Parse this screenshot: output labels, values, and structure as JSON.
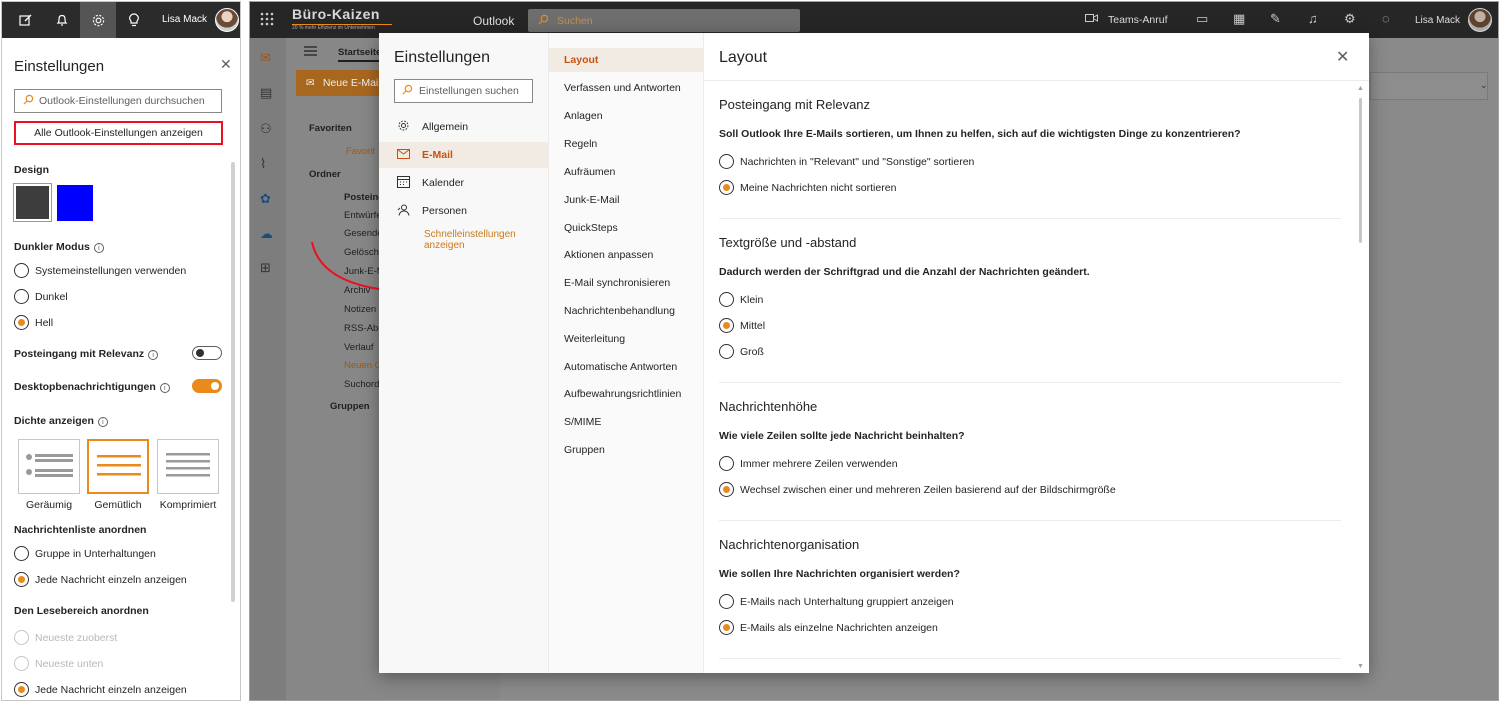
{
  "left_panel": {
    "user_name": "Lisa Mack",
    "title": "Einstellungen",
    "search_placeholder": "Outlook-Einstellungen durchsuchen",
    "all_settings_label": "Alle Outlook-Einstellungen anzeigen",
    "design_label": "Design",
    "swatches": [
      "#3d3d3d",
      "#0000ff"
    ],
    "dark_mode_label": "Dunkler Modus",
    "dark_mode_options": [
      {
        "label": "Systemeinstellungen verwenden",
        "checked": false
      },
      {
        "label": "Dunkel",
        "checked": false
      },
      {
        "label": "Hell",
        "checked": true
      }
    ],
    "focused_inbox_label": "Posteingang mit Relevanz",
    "focused_inbox_on": false,
    "desktop_notifications_label": "Desktopbenachrichtigungen",
    "desktop_notifications_on": true,
    "density_label": "Dichte anzeigen",
    "density_options": [
      "Geräumig",
      "Gemütlich",
      "Komprimiert"
    ],
    "density_selected": 1,
    "message_list_label": "Nachrichtenliste anordnen",
    "message_list_options": [
      {
        "label": "Gruppe in Unterhaltungen",
        "checked": false
      },
      {
        "label": "Jede Nachricht einzeln anzeigen",
        "checked": true
      }
    ],
    "reading_pane_label": "Den Lesebereich anordnen",
    "reading_pane_options": [
      {
        "label": "Neueste zuoberst",
        "checked": false,
        "disabled": true
      },
      {
        "label": "Neueste unten",
        "checked": false,
        "disabled": true
      },
      {
        "label": "Jede Nachricht einzeln anzeigen",
        "checked": true,
        "disabled": false
      }
    ]
  },
  "main": {
    "brand": "Büro-Kaizen",
    "brand_tagline": "20 % mehr Effizienz im Unternehmen",
    "app_name": "Outlook",
    "search_placeholder": "Suchen",
    "teams_call": "Teams-Anruf",
    "user_name": "Lisa Mack",
    "tab_label": "Startseite",
    "new_mail_label": "Neue E-Mail",
    "folders": {
      "favorites": "Favoriten",
      "favorites_item": "Favorit",
      "folder": "Ordner",
      "items": [
        "Posteingang",
        "Entwürfe",
        "Gesendet",
        "Gelöscht",
        "Junk-E-Mail",
        "Archiv",
        "Notizen",
        "RSS-Abo",
        "Verlauf",
        "Neuen Ordner",
        "Suchordner"
      ],
      "groups": "Gruppen"
    }
  },
  "modal": {
    "nav_title": "Einstellungen",
    "nav_search_placeholder": "Einstellungen suchen",
    "nav_items": [
      {
        "label": "Allgemein",
        "icon": "gear-icon"
      },
      {
        "label": "E-Mail",
        "icon": "mail-icon"
      },
      {
        "label": "Kalender",
        "icon": "calendar-icon"
      },
      {
        "label": "Personen",
        "icon": "people-icon"
      }
    ],
    "nav_active": 1,
    "quick_settings_link": "Schnelleinstellungen anzeigen",
    "sub_items": [
      "Layout",
      "Verfassen und Antworten",
      "Anlagen",
      "Regeln",
      "Aufräumen",
      "Junk-E-Mail",
      "QuickSteps",
      "Aktionen anpassen",
      "E-Mail synchronisieren",
      "Nachrichtenbehandlung",
      "Weiterleitung",
      "Automatische Antworten",
      "Aufbewahrungsrichtlinien",
      "S/MIME",
      "Gruppen"
    ],
    "sub_active": 0,
    "content_title": "Layout",
    "sections": [
      {
        "heading": "Posteingang mit Relevanz",
        "question": "Soll Outlook Ihre E-Mails sortieren, um Ihnen zu helfen, sich auf die wichtigsten Dinge zu konzentrieren?",
        "options": [
          {
            "label": "Nachrichten in \"Relevant\" und \"Sonstige\" sortieren",
            "checked": false
          },
          {
            "label": "Meine Nachrichten nicht sortieren",
            "checked": true
          }
        ]
      },
      {
        "heading": "Textgröße und -abstand",
        "question": "Dadurch werden der Schriftgrad und die Anzahl der Nachrichten geändert.",
        "options": [
          {
            "label": "Klein",
            "checked": false
          },
          {
            "label": "Mittel",
            "checked": true
          },
          {
            "label": "Groß",
            "checked": false
          }
        ]
      },
      {
        "heading": "Nachrichtenhöhe",
        "question": "Wie viele Zeilen sollte jede Nachricht beinhalten?",
        "options": [
          {
            "label": "Immer mehrere Zeilen verwenden",
            "checked": false
          },
          {
            "label": "Wechsel zwischen einer und mehreren Zeilen basierend auf der Bildschirmgröße",
            "checked": true
          }
        ]
      },
      {
        "heading": "Nachrichtenorganisation",
        "question": "Wie sollen Ihre Nachrichten organisiert werden?",
        "options": [
          {
            "label": "E-Mails nach Unterhaltung gruppiert anzeigen",
            "checked": false
          },
          {
            "label": "E-Mails als einzelne Nachrichten anzeigen",
            "checked": true
          }
        ]
      }
    ]
  },
  "colors": {
    "accent": "#ea8a1a",
    "highlight_box": "#e81123",
    "arrow": "#e81123"
  }
}
